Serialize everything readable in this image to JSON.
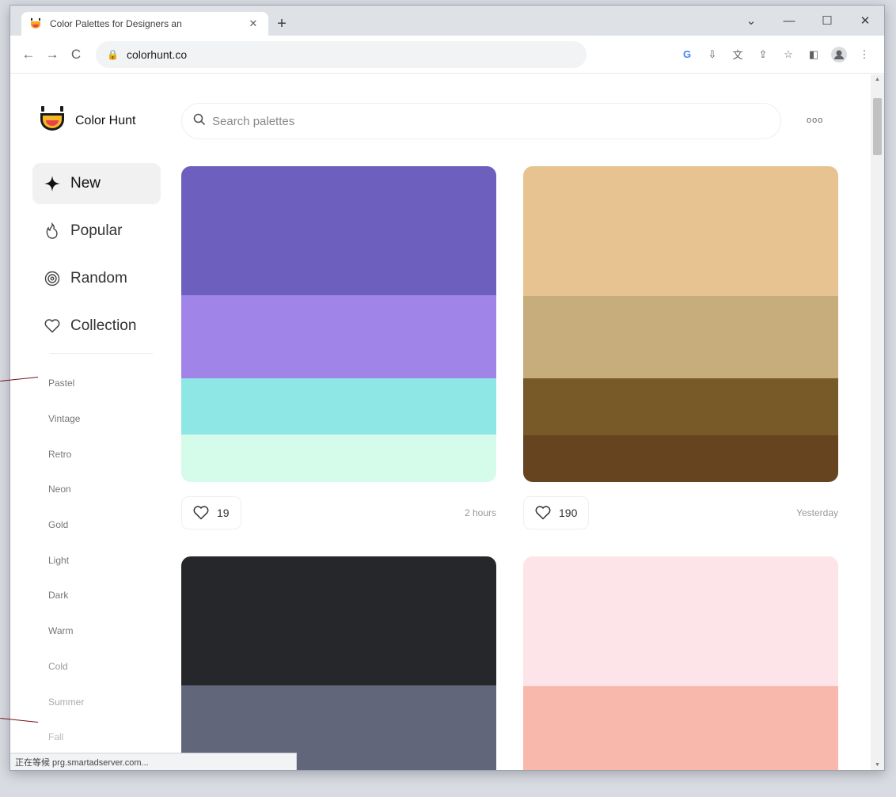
{
  "browser": {
    "tab_title": "Color Palettes for Designers an",
    "url": "colorhunt.co",
    "status_text": "正在等候 prg.smartadserver.com..."
  },
  "site": {
    "logo_text": "Color Hunt",
    "search_placeholder": "Search palettes",
    "more_label": "ooo"
  },
  "sidebar": {
    "nav": [
      {
        "label": "New",
        "icon": "sparkle-icon"
      },
      {
        "label": "Popular",
        "icon": "flame-icon"
      },
      {
        "label": "Random",
        "icon": "spiral-icon"
      },
      {
        "label": "Collection",
        "icon": "heart-icon"
      }
    ],
    "tags": [
      "Pastel",
      "Vintage",
      "Retro",
      "Neon",
      "Gold",
      "Light",
      "Dark",
      "Warm",
      "Cold",
      "Summer",
      "Fall"
    ]
  },
  "palettes": [
    {
      "colors": [
        "#6c5fbe",
        "#a084e8",
        "#8ee7e5",
        "#d5fbea"
      ],
      "likes": "19",
      "time": "2 hours"
    },
    {
      "colors": [
        "#e8c392",
        "#c7ad7b",
        "#775a28",
        "#674420"
      ],
      "likes": "190",
      "time": "Yesterday"
    },
    {
      "colors": [
        "#25272a",
        "#62667a"
      ],
      "likes": "",
      "time": ""
    },
    {
      "colors": [
        "#fce4e8",
        "#f9b8ac"
      ],
      "likes": "",
      "time": ""
    }
  ],
  "colors": {
    "accent_dark": "#111111",
    "tag_text": "#777777"
  }
}
